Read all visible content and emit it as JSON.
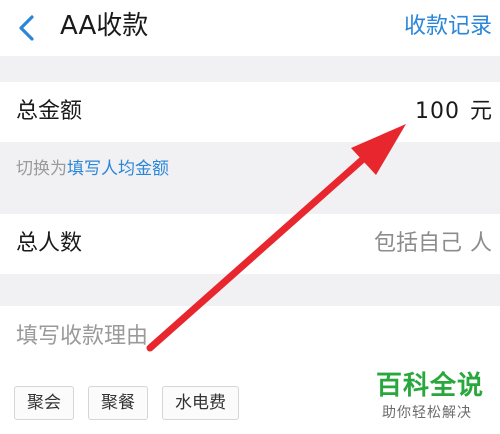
{
  "navbar": {
    "title": "AA收款",
    "action_label": "收款记录"
  },
  "total_row": {
    "label": "总金额",
    "amount": "100",
    "unit": "元"
  },
  "switch_hint": {
    "prefix": "切换为",
    "link": "填写人均金额"
  },
  "people_row": {
    "label": "总人数",
    "placeholder": "包括自己",
    "unit": "人"
  },
  "reason": {
    "placeholder": "填写收款理由",
    "value": ""
  },
  "tags": [
    "聚会",
    "聚餐",
    "水电费"
  ],
  "annotation": {
    "arrow_color": "#e8262e"
  },
  "watermark": {
    "title": "百科全说",
    "subtitle": "助你轻松解决"
  },
  "colors": {
    "accent": "#2a86d8",
    "background": "#f1f1f4",
    "watermark_green": "#28a83c"
  }
}
